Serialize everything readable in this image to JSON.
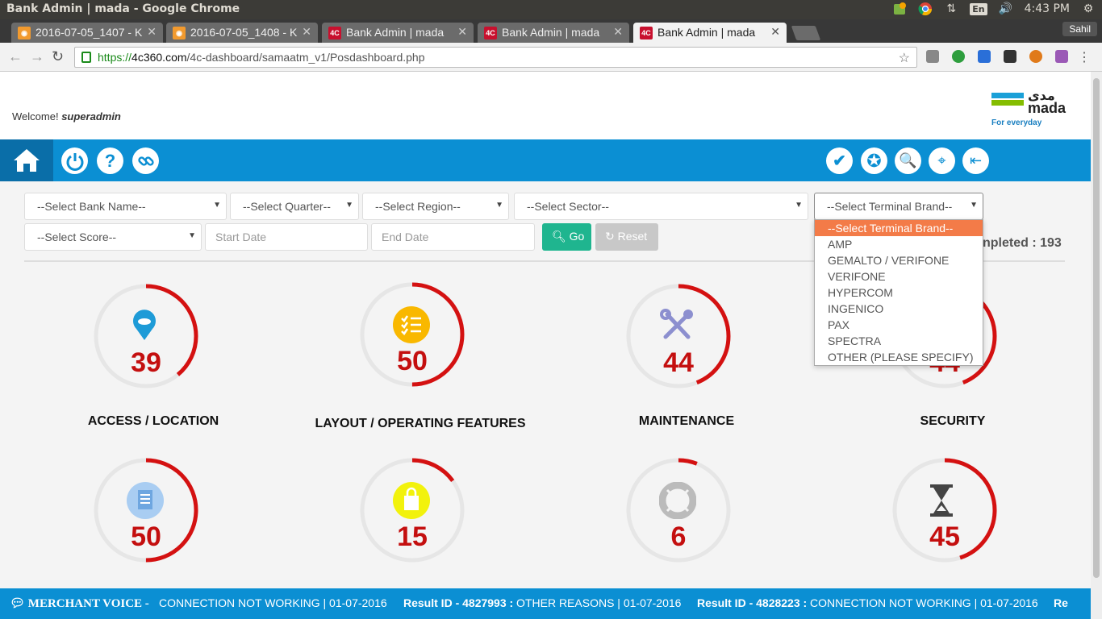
{
  "os": {
    "window_title": "Bank Admin | mada - Google Chrome",
    "lang": "En",
    "time": "4:43 PM"
  },
  "browser": {
    "tabs": [
      {
        "label": "2016-07-05_1407 - K",
        "icon": "rss-icon"
      },
      {
        "label": "2016-07-05_1408 - K",
        "icon": "rss-icon"
      },
      {
        "label": "Bank Admin | mada",
        "icon": "4c-icon"
      },
      {
        "label": "Bank Admin | mada",
        "icon": "4c-icon"
      },
      {
        "label": "Bank Admin | mada",
        "icon": "4c-icon",
        "active": true
      }
    ],
    "profile": "Sahil",
    "url_scheme": "https://",
    "url_host": "4c360.com",
    "url_path": "/4c-dashboard/samaatm_v1/Posdashboard.php"
  },
  "header": {
    "welcome_prefix": "Welcome!",
    "username": "superadmin",
    "logo_arabic": "مدى",
    "logo_text": "mada",
    "logo_tagline": "For everyday"
  },
  "filters": {
    "bank": "--Select Bank Name--",
    "quarter": "--Select Quarter--",
    "region": "--Select Region--",
    "sector": "--Select Sector--",
    "terminal_brand": "--Select Terminal Brand--",
    "score": "--Select Score--",
    "start_date_placeholder": "Start Date",
    "end_date_placeholder": "End Date",
    "go": "Go",
    "reset": "Reset",
    "completed": "npleted : 193"
  },
  "terminal_brand_options": [
    "--Select Terminal Brand--",
    "AMP",
    "GEMALTO / VERIFONE",
    "VERIFONE",
    "HYPERCOM",
    "INGENICO",
    "PAX",
    "SPECTRA",
    "OTHER (PLEASE SPECIFY)"
  ],
  "gauges": [
    {
      "value": "39",
      "pct": 39,
      "label": "ACCESS / LOCATION",
      "icon": "location-pin-icon"
    },
    {
      "value": "50",
      "pct": 50,
      "label": "LAYOUT / OPERATING FEATURES",
      "icon": "checklist-icon"
    },
    {
      "value": "44",
      "pct": 44,
      "label": "MAINTENANCE",
      "icon": "tools-icon"
    },
    {
      "value": "44",
      "pct": 44,
      "label": "SECURITY",
      "icon": "security-icon"
    },
    {
      "value": "50",
      "pct": 50,
      "label": "",
      "icon": "document-icon"
    },
    {
      "value": "15",
      "pct": 15,
      "label": "",
      "icon": "shopping-bag-icon"
    },
    {
      "value": "6",
      "pct": 6,
      "label": "",
      "icon": "lifebuoy-icon"
    },
    {
      "value": "45",
      "pct": 45,
      "label": "",
      "icon": "hourglass-icon"
    }
  ],
  "ticker": {
    "title": "MERCHANT VOICE -",
    "items": [
      {
        "prefix": "",
        "text": "CONNECTION NOT WORKING | 01-07-2016"
      },
      {
        "prefix": "Result ID - 4827993 :",
        "text": " OTHER REASONS | 01-07-2016"
      },
      {
        "prefix": "Result ID - 4828223 :",
        "text": " CONNECTION NOT WORKING | 01-07-2016"
      },
      {
        "prefix": "Re",
        "text": ""
      }
    ]
  },
  "colors": {
    "brand_blue": "#0b8fd3",
    "gauge_red": "#c40f0f",
    "go_green": "#1fb58f",
    "highlight_orange": "#f37b48"
  }
}
